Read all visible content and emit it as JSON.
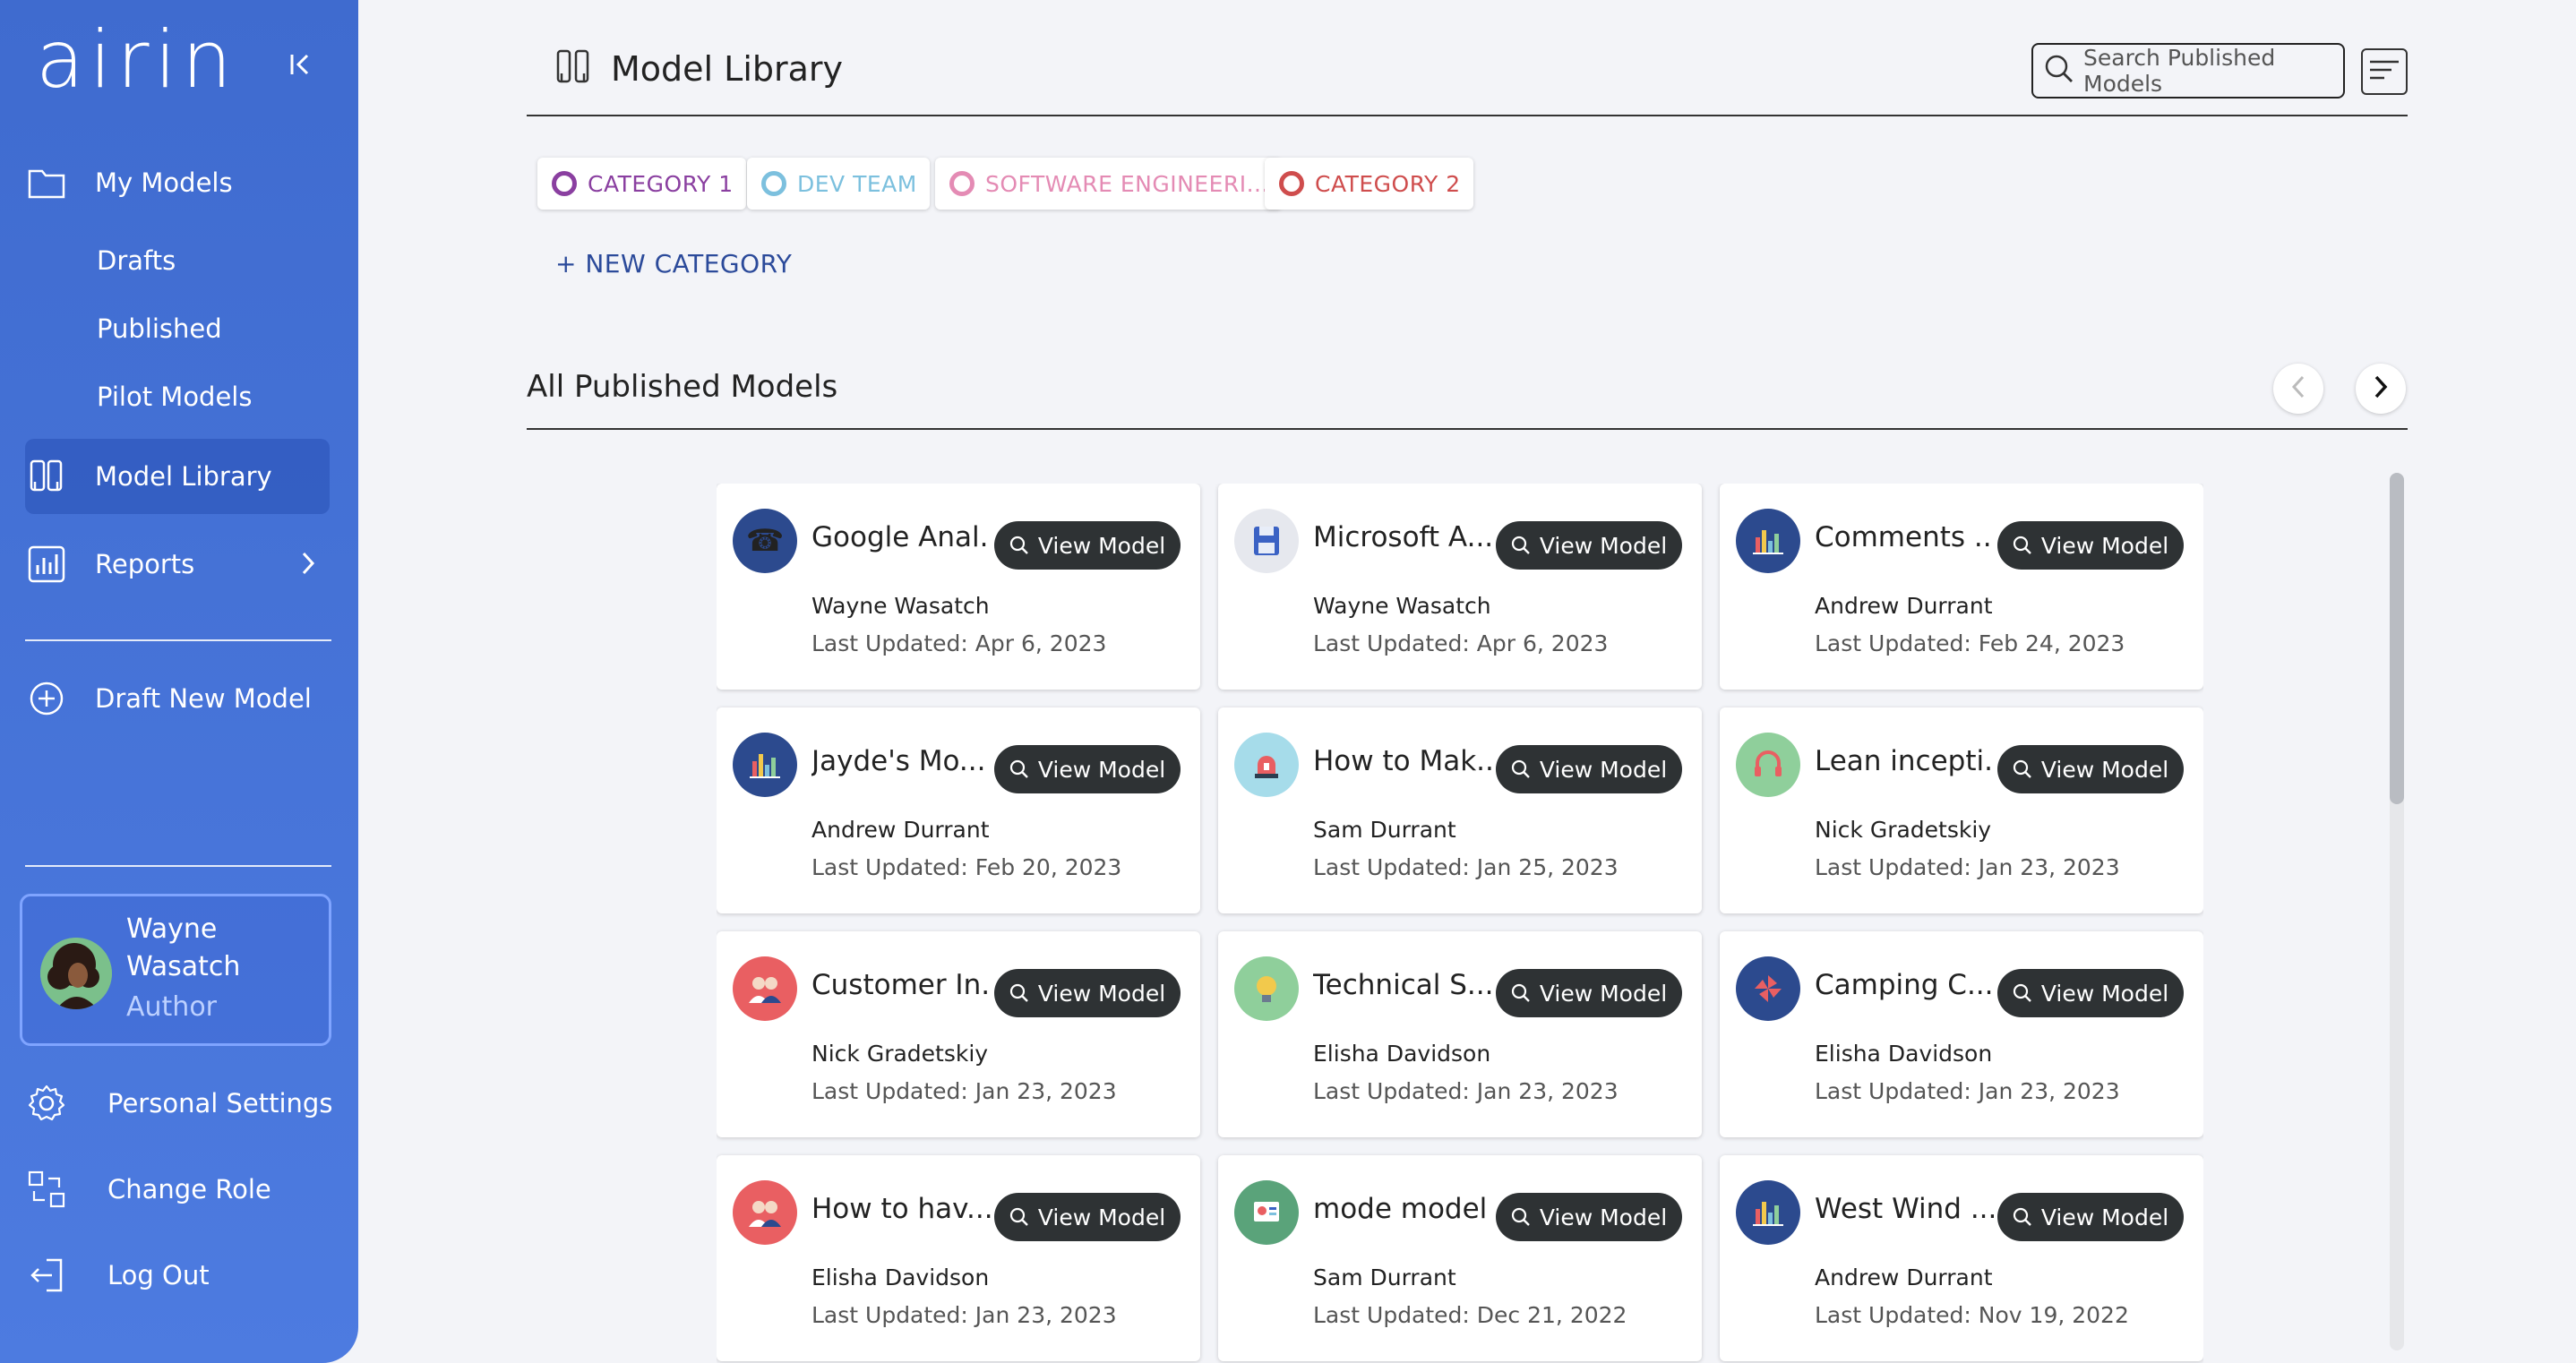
{
  "app": {
    "logo_text": "airin"
  },
  "sidebar": {
    "my_models": "My Models",
    "drafts": "Drafts",
    "published": "Published",
    "pilot_models": "Pilot Models",
    "model_library": "Model Library",
    "reports": "Reports",
    "draft_new_model": "Draft New Model",
    "personal_settings": "Personal Settings",
    "change_role": "Change Role",
    "log_out": "Log Out"
  },
  "user": {
    "name": "Wayne Wasatch",
    "role": "Author"
  },
  "header": {
    "title": "Model Library",
    "search_placeholder": "Search Published Models"
  },
  "categories": [
    {
      "label": "CATEGORY 1",
      "color": "#8a3fa0"
    },
    {
      "label": "DEV TEAM",
      "color": "#7cc0de"
    },
    {
      "label": "SOFTWARE ENGINEERI...",
      "color": "#e48bb4"
    },
    {
      "label": "CATEGORY 2",
      "color": "#cf4d4d"
    }
  ],
  "new_category": "+ NEW CATEGORY",
  "section": {
    "title": "All Published Models"
  },
  "view_label": "View Model",
  "models": [
    {
      "name": "Google Anal...",
      "author": "Wayne Wasatch",
      "updated": "Last Updated: Apr 6, 2023",
      "icon": "telephone-icon",
      "bg": "#2c4a8e"
    },
    {
      "name": "Microsoft A...",
      "author": "Wayne Wasatch",
      "updated": "Last Updated: Apr 6, 2023",
      "icon": "floppy-icon",
      "bg": "#e6e8ee"
    },
    {
      "name": "Comments ...",
      "author": "Andrew Durrant",
      "updated": "Last Updated: Feb 24, 2023",
      "icon": "bar-chart-icon",
      "bg": "#2c4a8e"
    },
    {
      "name": "Jayde's Mo...",
      "author": "Andrew Durrant",
      "updated": "Last Updated: Feb 20, 2023",
      "icon": "bar-chart-icon",
      "bg": "#2c4a8e"
    },
    {
      "name": "How to Mak...",
      "author": "Sam Durrant",
      "updated": "Last Updated: Jan 25, 2023",
      "icon": "siren-icon",
      "bg": "#a6dcea"
    },
    {
      "name": "Lean incepti...",
      "author": "Nick Gradetskiy",
      "updated": "Last Updated: Jan 23, 2023",
      "icon": "headset-icon",
      "bg": "#8fcf9b"
    },
    {
      "name": "Customer In...",
      "author": "Nick Gradetskiy",
      "updated": "Last Updated: Jan 23, 2023",
      "icon": "people-icon",
      "bg": "#e95f62"
    },
    {
      "name": "Technical S...",
      "author": "Elisha Davidson",
      "updated": "Last Updated: Jan 23, 2023",
      "icon": "lightbulb-head-icon",
      "bg": "#8fcf9b"
    },
    {
      "name": "Camping C...",
      "author": "Elisha Davidson",
      "updated": "Last Updated: Jan 23, 2023",
      "icon": "pinwheel-icon",
      "bg": "#2c4a8e"
    },
    {
      "name": "How to hav...",
      "author": "Elisha Davidson",
      "updated": "Last Updated: Jan 23, 2023",
      "icon": "people-icon",
      "bg": "#e95f62"
    },
    {
      "name": "mode model",
      "author": "Sam Durrant",
      "updated": "Last Updated: Dec 21, 2022",
      "icon": "dashboard-icon",
      "bg": "#5aa37a"
    },
    {
      "name": "West Wind ...",
      "author": "Andrew Durrant",
      "updated": "Last Updated: Nov 19, 2022",
      "icon": "bar-chart-icon",
      "bg": "#2c4a8e"
    }
  ]
}
